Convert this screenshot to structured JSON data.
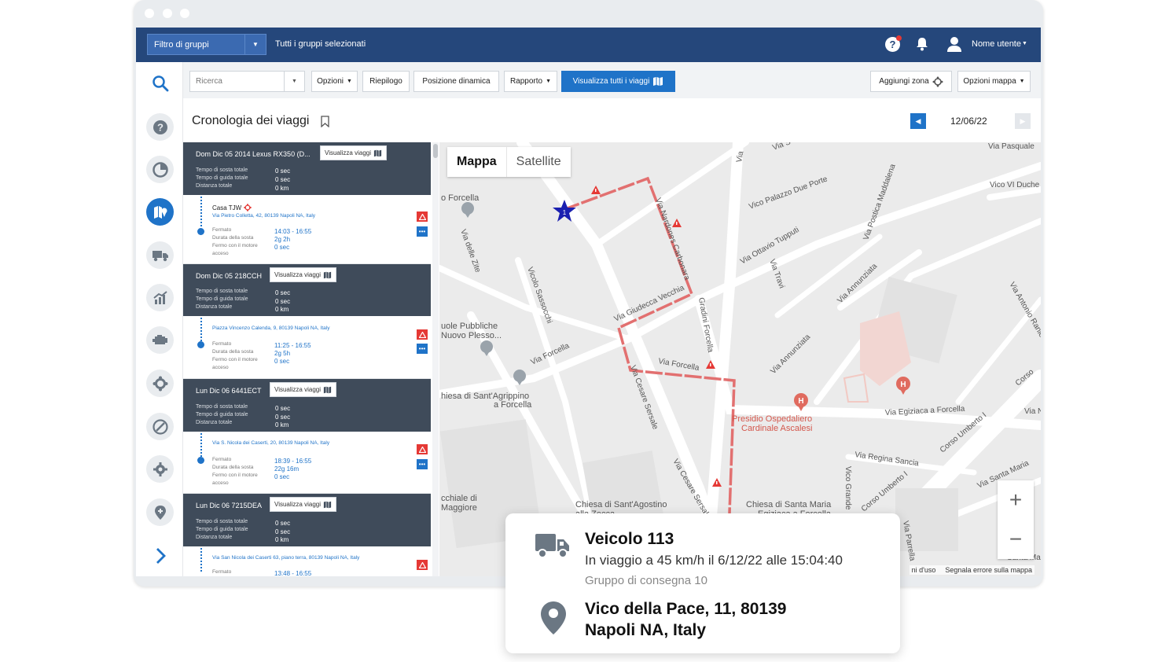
{
  "topbar": {
    "group_filter": "Filtro di gruppi",
    "groups_selected": "Tutti i gruppi selezionati",
    "user_name": "Nome utente"
  },
  "toolbar": {
    "search_placeholder": "Ricerca",
    "options": "Opzioni",
    "summary": "Riepilogo",
    "dynamic_position": "Posizione dinamica",
    "report": "Rapporto",
    "view_all_trips": "Visualizza tutti i viaggi",
    "add_zone": "Aggiungi zona",
    "map_options": "Opzioni mappa"
  },
  "page": {
    "title": "Cronologia dei viaggi",
    "date": "12/06/22"
  },
  "labels": {
    "total_stop_time": "Tempo di sosta totale",
    "total_drive_time": "Tempo di guida totale",
    "total_distance": "Distanza totale",
    "stopped": "Fermato",
    "stop_duration": "Durata della sosta",
    "engine_on_stop_1": "Fermo con il motore",
    "engine_on_stop_2": "acceso",
    "view_trips": "Visualizza viaggi"
  },
  "trips": [
    {
      "name": "Dom Dic 05 2014 Lexus RX350 (D...",
      "stop_time": "0 sec",
      "drive_time": "0 sec",
      "distance": "0 km",
      "stop_name": "Casa TJW",
      "address": "Via Pietro Colletta, 42, 80139 Napoli NA, Italy",
      "time": "14:03 - 16:55",
      "duration": "2g 2h",
      "idle": "0 sec"
    },
    {
      "name": "Dom Dic 05 218CCH",
      "stop_time": "0 sec",
      "drive_time": "0 sec",
      "distance": "0 km",
      "address": "Piazza Vincenzo Calenda, 9, 80139 Napoli NA, Italy",
      "time": "11:25 - 16:55",
      "duration": "2g 5h",
      "idle": "0 sec"
    },
    {
      "name": "Lun Dic 06 6441ECT",
      "stop_time": "0 sec",
      "drive_time": "0 sec",
      "distance": "0 km",
      "address": "Via S. Nicola dei Caserti, 20, 80139 Napoli NA, Italy",
      "time": "18:39 - 16:55",
      "duration": "22g 16m",
      "idle": "0 sec"
    },
    {
      "name": "Lun Dic 06 7215DEA",
      "stop_time": "0 sec",
      "drive_time": "0 sec",
      "distance": "0 km",
      "address": "Via San Nicola dei Caserti 63, piano terra, 80139 Napoli NA, Italy",
      "time": "13:48 - 16:55"
    }
  ],
  "map": {
    "tab_map": "Mappa",
    "tab_satellite": "Satellite",
    "terms": "ni d'uso",
    "report_error": "Segnala errore sulla mappa",
    "zoom_in": "+",
    "zoom_out": "−",
    "marker_number": "1",
    "streets": {
      "forcella_top": "o Forcella",
      "pasquale": "Via Pasquale",
      "vico_duche": "Vico VI Duche",
      "palazzo": "Vico Palazzo Due Porte",
      "maddalena": "Via Postica Maddalena",
      "tupputi": "Via Ottavio Tupputi",
      "travi": "Via Travi",
      "annunziata1": "Via Annunziata",
      "annunziata2": "Via Annunziata",
      "antonio": "Via Antonio Ranieri",
      "zite": "Via delle Zite",
      "sassocchi": "Vicolo Sassocchi",
      "forcella1": "Via Forcella",
      "forcella2": "Via Forcella",
      "giudecca": "Via Giudecca Vecchia",
      "forcella_vert": "Via Nardones Carbonara",
      "gradini": "Gradini Forcella",
      "sersale1": "Via Cesare Sersale",
      "sersale2": "Via Cesare Sersale",
      "egiziaca": "Via Egiziaca a Forcella",
      "regina": "Via Regina Sancia",
      "umberto1": "Corso Umberto I",
      "umberto2": "Corso Umberto I",
      "grande": "Vico Grande",
      "parrella": "Via Parrella",
      "santa_maria": "Via Santa Maria",
      "corso": "Corso",
      "scuole": "uole Pubbliche",
      "scuole2": "Nuovo Plesso...",
      "chiesa_agrippino1": "hiesa di Sant'Agrippino",
      "chiesa_agrippino2": "a Forcella",
      "hospital1": "Presidio Ospedaliero",
      "hospital2": "Cardinale Ascalesi",
      "chiesa_maggiore1": "cchiale di",
      "chiesa_maggiore2": "Maggiore",
      "chiesa_agostino1": "Chiesa di Sant'Agostino",
      "chiesa_agostino2": "alla Zecca",
      "chiesa_santamaria1": "Chiesa di Santa Maria",
      "chiesa_santamaria2": "Egiziaca a Forcella",
      "via_n": "Via N",
      "via_s": "Via S",
      "via_top": "Via",
      "santa_ma": "Santa Ma"
    }
  },
  "popup": {
    "vehicle": "Veicolo 113",
    "status": "In viaggio a 45 km/h il 6/12/22 alle 15:04:40",
    "group": "Gruppo di consegna 10",
    "address_line1": "Vico della Pace, 11, 80139",
    "address_line2": "Napoli NA, Italy"
  },
  "colors": {
    "nav": "#25477b",
    "accent": "#1f73c8",
    "trip_header": "#3f4b5a",
    "route": "#e05050",
    "warning": "#e53935"
  }
}
